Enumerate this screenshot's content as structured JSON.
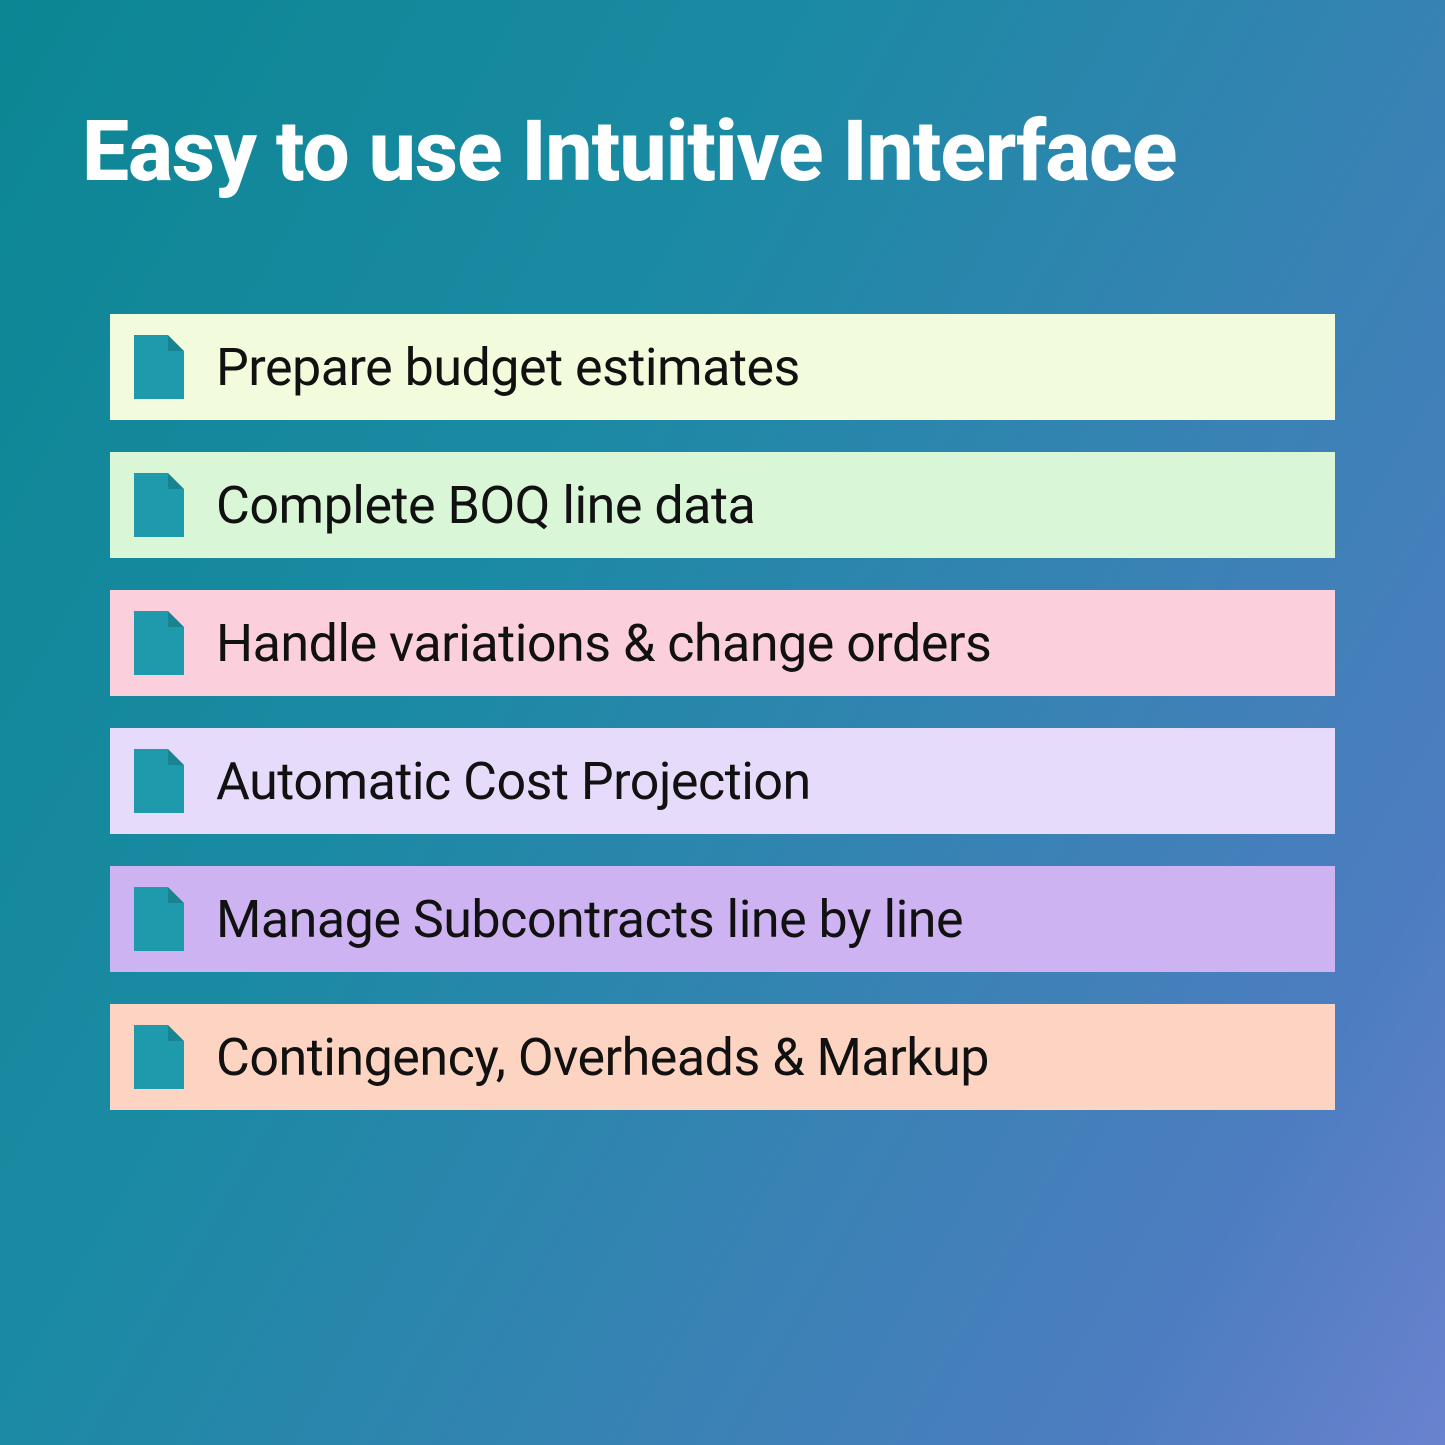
{
  "title": "Easy to use Intuitive Interface",
  "features": [
    {
      "label": "Prepare budget estimates",
      "bg": "#f3fbdd"
    },
    {
      "label": "Complete BOQ line data",
      "bg": "#d9f6d6"
    },
    {
      "label": "Handle variations & change orders",
      "bg": "#fbcfdb"
    },
    {
      "label": "Automatic Cost Projection",
      "bg": "#e6dbfb"
    },
    {
      "label": "Manage Subcontracts line by line",
      "bg": "#cdb3f1"
    },
    {
      "label": "Contingency, Overheads & Markup",
      "bg": "#fdd4c2"
    }
  ],
  "icon_color": "#1f9aac"
}
